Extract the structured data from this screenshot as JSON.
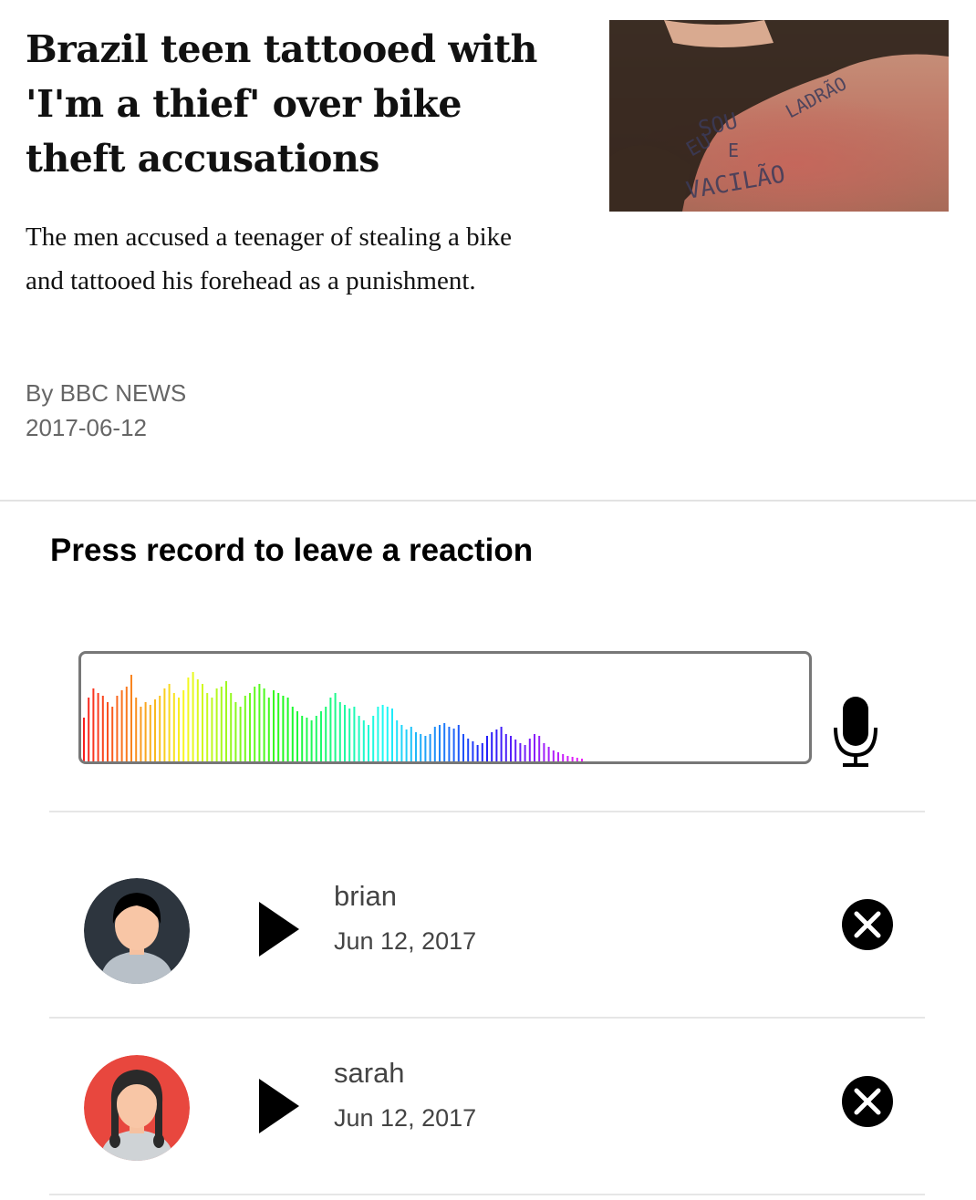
{
  "article": {
    "headline": "Brazil teen tattooed with 'I'm a thief' over bike theft accusations",
    "summary": "The men accused a teenager of stealing a bike and tattooed his forehead as a punishment.",
    "byline": "By BBC NEWS",
    "date": "2017-06-12",
    "image_tattoo_text": "EU SOU LADRÃO E VACILÃO"
  },
  "recorder": {
    "prompt": "Press record to leave a reaction",
    "record_icon": "microphone-icon"
  },
  "reactions": [
    {
      "name": "brian",
      "date": "Jun 12, 2017",
      "avatar_bg": "#2d353e",
      "avatar": "male-avatar-icon"
    },
    {
      "name": "sarah",
      "date": "Jun 12, 2017",
      "avatar_bg": "#e8473e",
      "avatar": "female-avatar-icon"
    }
  ],
  "icons": {
    "play": "play-icon",
    "delete": "close-circle-icon"
  }
}
